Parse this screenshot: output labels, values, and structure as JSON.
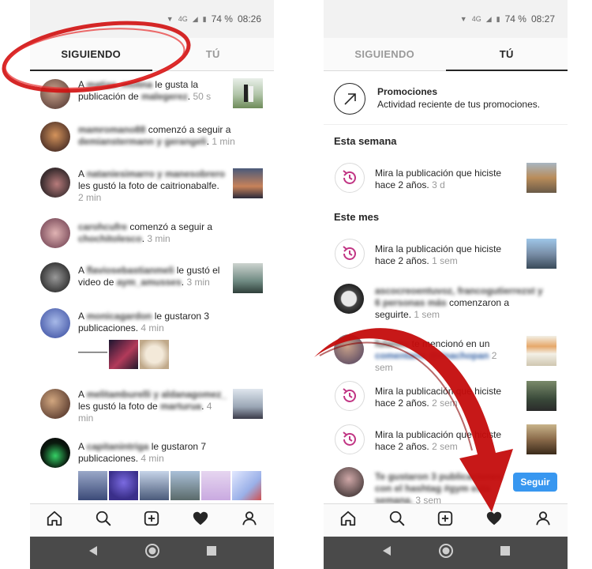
{
  "left": {
    "status": {
      "network": "4G",
      "battery": "74 %",
      "time": "08:26"
    },
    "tabs": [
      "SIGUIENDO",
      "TÚ"
    ],
    "items": [
      {
        "pre": "A ",
        "blur1": "matias_molina",
        "mid": " le gusta la publicación de ",
        "blur2": "malegerez",
        "post": ".",
        "time": "50 s"
      },
      {
        "pre": "",
        "blur1": "mamromano88",
        "mid": " comenzó a seguir a ",
        "blur2": "demianstermann y gerangeli",
        "post": ".",
        "time": "1 min"
      },
      {
        "pre": "A ",
        "blur1": "nataniesimarro y manesobrero",
        "mid": " les gustó la foto de caitrionabalfe.",
        "blur2": "",
        "post": "",
        "time": "2 min"
      },
      {
        "pre": "",
        "blur1": "carohcufre",
        "mid": " comenzó a seguir a ",
        "blur2": "chochitolesco",
        "post": ".",
        "time": "3 min"
      },
      {
        "pre": "A ",
        "blur1": "flaviosebastianmeli",
        "mid": " le gustó el video de ",
        "blur2": "aym_amusses",
        "post": ".",
        "time": "3 min"
      },
      {
        "pre": "A ",
        "blur1": "monicagardon",
        "mid": " le gustaron 3 publicaciones.",
        "blur2": "",
        "post": "",
        "time": "4 min"
      },
      {
        "pre": "A ",
        "blur1": "melitamburelli y aldanagomez_",
        "mid": " les gustó la foto de ",
        "blur2": "marturua",
        "post": ".",
        "time": "4 min"
      },
      {
        "pre": "A ",
        "blur1": "capitanintriga",
        "mid": " le gustaron 7 publicaciones.",
        "blur2": "",
        "post": "",
        "time": "4 min"
      }
    ]
  },
  "right": {
    "status": {
      "network": "4G",
      "battery": "74 %",
      "time": "08:27"
    },
    "tabs": [
      "SIGUIENDO",
      "TÚ"
    ],
    "promo": {
      "title": "Promociones",
      "subtitle": "Actividad reciente de tus promociones."
    },
    "section_week": "Esta semana",
    "section_month": "Este mes",
    "memory_text": "Mira la publicación que hiciste hace 2 años.",
    "items": [
      {
        "time": "3 d"
      },
      {
        "time": "1 sem"
      },
      {
        "blur1": "ascocreoentuvoz, francogutierrezst y 6 personas más",
        "mid": " comenzaron a seguirte.",
        "time": "1 sem"
      },
      {
        "blur1": "fulanito",
        "mid": " te mencionó en un ",
        "blur2": "comentario @rinachopan",
        "time": "2 sem"
      },
      {
        "time": "2 sem"
      },
      {
        "time": "2 sem"
      },
      {
        "blur1": "Te gustaron 3 publicaciones con el hashtag #gym esta semana.",
        "time": "3 sem",
        "button": "Seguir"
      }
    ]
  },
  "colors": {
    "follow_button": "#3897f0",
    "annotation_red": "#d01010"
  },
  "icons": [
    "home-icon",
    "search-icon",
    "add-icon",
    "heart-icon",
    "profile-icon",
    "back-icon",
    "home-button-icon",
    "recents-icon"
  ]
}
